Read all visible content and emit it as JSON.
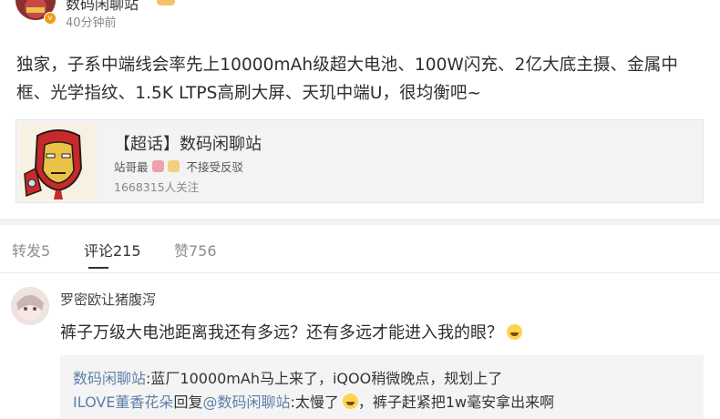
{
  "post": {
    "author": "数码闲聊站",
    "time": "40分钟前",
    "text": "独家，子系中端线会率先上10000mAh级超大电池、100W闪充、2亿大底主摄、金属中框、光学指纹、1.5K LTPS高刷大屏、天玑中端U，很均衡吧~"
  },
  "topic_card": {
    "title": "【超话】数码闲聊站",
    "host_label": "站哥最",
    "host_note": "不接受反驳",
    "followers": "1668315人关注",
    "thumb_icon": "iron-man-avatar"
  },
  "tabs": [
    {
      "label": "转发5"
    },
    {
      "label": "评论215"
    },
    {
      "label": "赞756"
    }
  ],
  "active_tab": "评论215",
  "comment": {
    "user": "罗密欧让猪腹泻",
    "text": "裤子万级大电池距离我还有多远？还有多远才能进入我的眼？",
    "replies": [
      {
        "user": "数码闲聊站",
        "text": ":蓝厂10000mAh马上来了，iQOO稍微晚点，规划上了"
      },
      {
        "user": "ILOVE董香花朵",
        "mid": "回复",
        "mention": "@数码闲聊站",
        "text": ":太慢了",
        "tail": "，裤子赶紧把1w毫安拿出来啊"
      }
    ]
  },
  "colors": {
    "link": "#5d7fa8",
    "accent_badge": "#f39b14",
    "card_bg": "#f3f3f3"
  }
}
